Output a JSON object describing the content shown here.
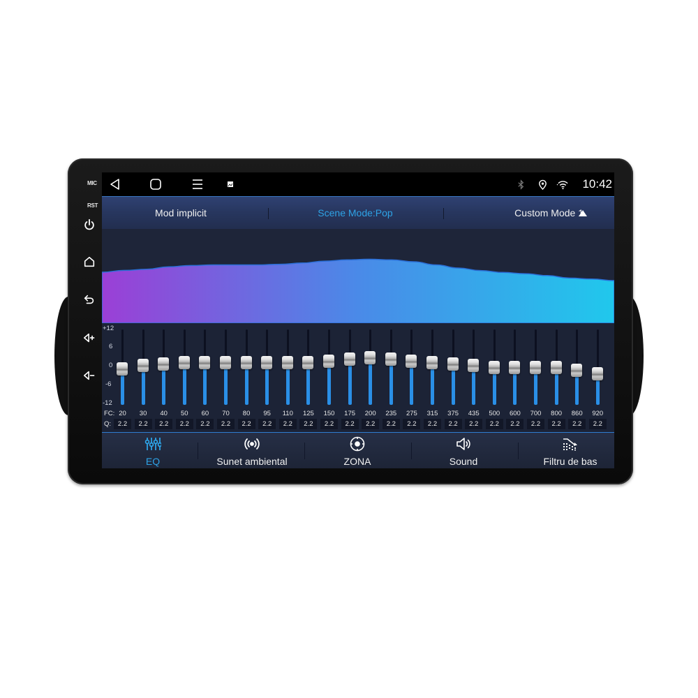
{
  "device": {
    "side_labels": {
      "mic": "MIC",
      "rst": "RST"
    },
    "side_buttons": [
      {
        "name": "power",
        "icon": "power-icon"
      },
      {
        "name": "home",
        "icon": "home-icon"
      },
      {
        "name": "back",
        "icon": "back-arrow-icon"
      },
      {
        "name": "volume-up",
        "icon": "volume-up-icon"
      },
      {
        "name": "volume-down",
        "icon": "volume-down-icon"
      }
    ]
  },
  "statusbar": {
    "nav": [
      "back-triangle-icon",
      "home-square-icon",
      "menu-lines-icon",
      "notification-image-icon"
    ],
    "icons": [
      "bluetooth-icon",
      "location-icon",
      "wifi-icon"
    ],
    "time": "10:42"
  },
  "modebar": {
    "items": [
      {
        "label": "Mod implicit",
        "active": false
      },
      {
        "label": "Scene Mode:Pop",
        "active": true
      },
      {
        "label": "Custom Mode 1",
        "active": false
      }
    ],
    "expand_icon": "triangle-up-icon"
  },
  "colors": {
    "accent": "#2ea3e6",
    "curve_start": "#9b3fd6",
    "curve_mid": "#4a8ae8",
    "curve_end": "#20c8ec",
    "slider_fill": "#2a8fe6"
  },
  "equalizer": {
    "db_scale": [
      "+12",
      "6",
      "0",
      "-6",
      "-12"
    ],
    "db_range": [
      -12,
      12
    ],
    "fc_label": "FC:",
    "q_label": "Q:",
    "bands": [
      {
        "fc": "20",
        "q": "2.2",
        "gain_db": -0.5
      },
      {
        "fc": "30",
        "q": "2.2",
        "gain_db": 0.5
      },
      {
        "fc": "40",
        "q": "2.2",
        "gain_db": 1
      },
      {
        "fc": "50",
        "q": "2.2",
        "gain_db": 1.5
      },
      {
        "fc": "60",
        "q": "2.2",
        "gain_db": 1.5
      },
      {
        "fc": "70",
        "q": "2.2",
        "gain_db": 1.5
      },
      {
        "fc": "80",
        "q": "2.2",
        "gain_db": 1.5
      },
      {
        "fc": "95",
        "q": "2.2",
        "gain_db": 1.5
      },
      {
        "fc": "110",
        "q": "2.2",
        "gain_db": 1.5
      },
      {
        "fc": "125",
        "q": "2.2",
        "gain_db": 1.5
      },
      {
        "fc": "150",
        "q": "2.2",
        "gain_db": 2
      },
      {
        "fc": "175",
        "q": "2.2",
        "gain_db": 2.5
      },
      {
        "fc": "200",
        "q": "2.2",
        "gain_db": 3
      },
      {
        "fc": "235",
        "q": "2.2",
        "gain_db": 2.5
      },
      {
        "fc": "275",
        "q": "2.2",
        "gain_db": 2
      },
      {
        "fc": "315",
        "q": "2.2",
        "gain_db": 1.5
      },
      {
        "fc": "375",
        "q": "2.2",
        "gain_db": 1
      },
      {
        "fc": "435",
        "q": "2.2",
        "gain_db": 0.5
      },
      {
        "fc": "500",
        "q": "2.2",
        "gain_db": 0
      },
      {
        "fc": "600",
        "q": "2.2",
        "gain_db": 0
      },
      {
        "fc": "700",
        "q": "2.2",
        "gain_db": 0
      },
      {
        "fc": "800",
        "q": "2.2",
        "gain_db": 0
      },
      {
        "fc": "860",
        "q": "2.2",
        "gain_db": -1
      },
      {
        "fc": "920",
        "q": "2.2",
        "gain_db": -2
      }
    ]
  },
  "bottom_tabs": [
    {
      "label": "EQ",
      "icon": "equalizer-sliders-icon",
      "active": true
    },
    {
      "label": "Sunet ambiental",
      "icon": "surround-sound-icon",
      "active": false
    },
    {
      "label": "ZONA",
      "icon": "zone-target-icon",
      "active": false
    },
    {
      "label": "Sound",
      "icon": "speaker-icon",
      "active": false
    },
    {
      "label": "Filtru de bas",
      "icon": "bass-filter-icon",
      "active": false
    }
  ]
}
